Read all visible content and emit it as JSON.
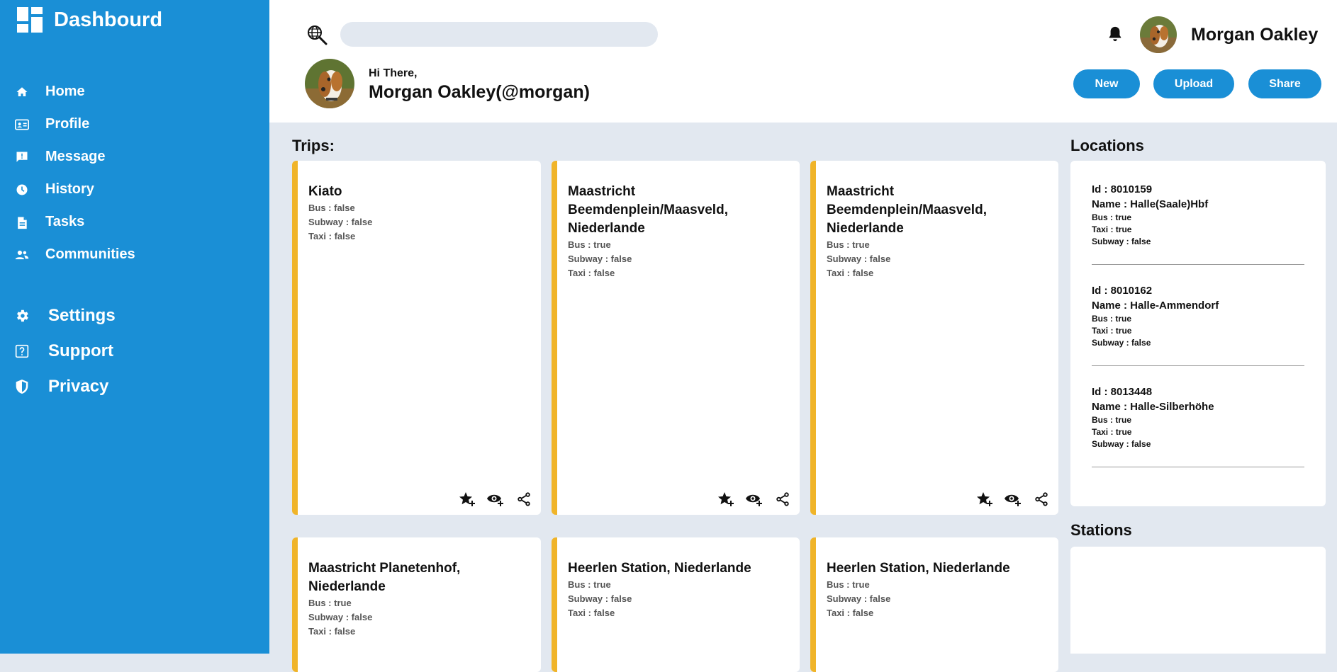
{
  "brand": {
    "title": "Dashbourd"
  },
  "nav": {
    "items": [
      {
        "label": "Home",
        "icon": "home-icon"
      },
      {
        "label": "Profile",
        "icon": "id-card-icon"
      },
      {
        "label": "Message",
        "icon": "message-alert-icon"
      },
      {
        "label": "History",
        "icon": "clock-icon"
      },
      {
        "label": "Tasks",
        "icon": "clipboard-icon"
      },
      {
        "label": "Communities",
        "icon": "people-icon"
      }
    ],
    "secondary": [
      {
        "label": "Settings",
        "icon": "gear-icon"
      },
      {
        "label": "Support",
        "icon": "help-icon"
      },
      {
        "label": "Privacy",
        "icon": "shield-icon"
      }
    ]
  },
  "header": {
    "search_placeholder": "",
    "user_name": "Morgan Oakley",
    "greeting": "Hi There,",
    "handle": "Morgan Oakley(@morgan)",
    "buttons": {
      "new": "New",
      "upload": "Upload",
      "share": "Share"
    }
  },
  "trips": {
    "title": "Trips:",
    "cards": [
      {
        "name": "Kiato",
        "bus": "Bus : false",
        "subway": "Subway : false",
        "taxi": "Taxi : false"
      },
      {
        "name": "Maastricht Beemdenplein/Maasveld, Niederlande",
        "bus": "Bus : true",
        "subway": "Subway : false",
        "taxi": "Taxi : false"
      },
      {
        "name": "Maastricht Beemdenplein/Maasveld, Niederlande",
        "bus": "Bus : true",
        "subway": "Subway : false",
        "taxi": "Taxi : false"
      },
      {
        "name": "Maastricht Planetenhof, Niederlande",
        "bus": "Bus : true",
        "subway": "Subway : false",
        "taxi": "Taxi : false"
      },
      {
        "name": "Heerlen Station, Niederlande",
        "bus": "Bus : true",
        "subway": "Subway : false",
        "taxi": "Taxi : false"
      },
      {
        "name": "Heerlen Station, Niederlande",
        "bus": "Bus : true",
        "subway": "Subway : false",
        "taxi": "Taxi : false"
      }
    ]
  },
  "locations": {
    "title": "Locations",
    "items": [
      {
        "id": "Id : 8010159",
        "name": "Name : Halle(Saale)Hbf",
        "bus": "Bus : true",
        "taxi": "Taxi : true",
        "subway": "Subway : false"
      },
      {
        "id": "Id : 8010162",
        "name": "Name : Halle-Ammendorf",
        "bus": "Bus : true",
        "taxi": "Taxi : true",
        "subway": "Subway : false"
      },
      {
        "id": "Id : 8013448",
        "name": "Name : Halle-Silberhöhe",
        "bus": "Bus : true",
        "taxi": "Taxi : true",
        "subway": "Subway : false"
      }
    ]
  },
  "stations": {
    "title": "Stations"
  },
  "colors": {
    "sidebar": "#1a8fd6",
    "accent": "#f0b429",
    "background": "#e2e8f0"
  }
}
